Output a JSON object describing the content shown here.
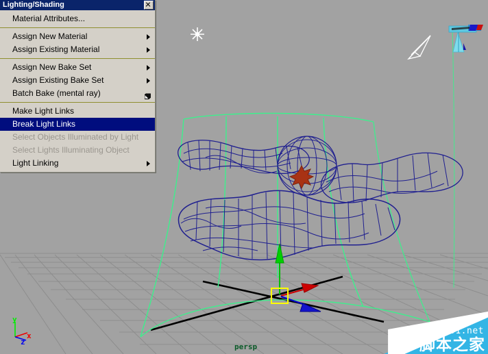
{
  "window": {
    "title": "Lighting/Shading",
    "close_icon": "close-icon"
  },
  "menu": {
    "items": [
      {
        "label": "Material Attributes...",
        "type": "item",
        "state": "normal",
        "trailing": "none"
      },
      {
        "label": "",
        "type": "separator"
      },
      {
        "label": "Assign New Material",
        "type": "item",
        "state": "normal",
        "trailing": "submenu-arrow"
      },
      {
        "label": "Assign Existing Material",
        "type": "item",
        "state": "normal",
        "trailing": "submenu-arrow"
      },
      {
        "label": "",
        "type": "separator"
      },
      {
        "label": "Assign New Bake Set",
        "type": "item",
        "state": "normal",
        "trailing": "submenu-arrow"
      },
      {
        "label": "Assign Existing Bake Set",
        "type": "item",
        "state": "normal",
        "trailing": "submenu-arrow"
      },
      {
        "label": "Batch Bake (mental ray)",
        "type": "item",
        "state": "normal",
        "trailing": "option-box"
      },
      {
        "label": "",
        "type": "separator"
      },
      {
        "label": "Make Light Links",
        "type": "item",
        "state": "normal",
        "trailing": "none"
      },
      {
        "label": "Break Light Links",
        "type": "item",
        "state": "selected",
        "trailing": "none"
      },
      {
        "label": "Select Objects Illuminated by Light",
        "type": "item",
        "state": "disabled",
        "trailing": "none"
      },
      {
        "label": "Select Lights Illuminating Object",
        "type": "item",
        "state": "disabled",
        "trailing": "none"
      },
      {
        "label": "Light Linking",
        "type": "item",
        "state": "normal",
        "trailing": "submenu-arrow"
      }
    ]
  },
  "viewport": {
    "camera_label": "persp",
    "background_color": "#a2a2a2",
    "wireframe_color": "#1f1f8f",
    "light_cone_color": "#3cf08c",
    "grid_color": "#8f8f8f",
    "axis_line_color": "#000000",
    "manipulator": {
      "name": "move-manipulator",
      "x_axis_color": "#cc0000",
      "y_axis_color": "#00cc00",
      "z_axis_color": "#0000cc",
      "center_handle_color": "#ffff00"
    },
    "axis_gizmo": {
      "x_label": "x",
      "y_label": "y",
      "z_label": "z",
      "x_color": "#ff0000",
      "y_color": "#00ff00",
      "z_color": "#0000ff"
    },
    "icons": {
      "point_light": "star-light-icon",
      "camera_cursor": "arrow-cursor-icon",
      "spot_light_manipulator": "spot-light-manipulator-icon",
      "selected_pivot": "pivot-marker-icon"
    }
  },
  "watermark": {
    "url": "jb51.net",
    "site_name": "脚本之家"
  }
}
